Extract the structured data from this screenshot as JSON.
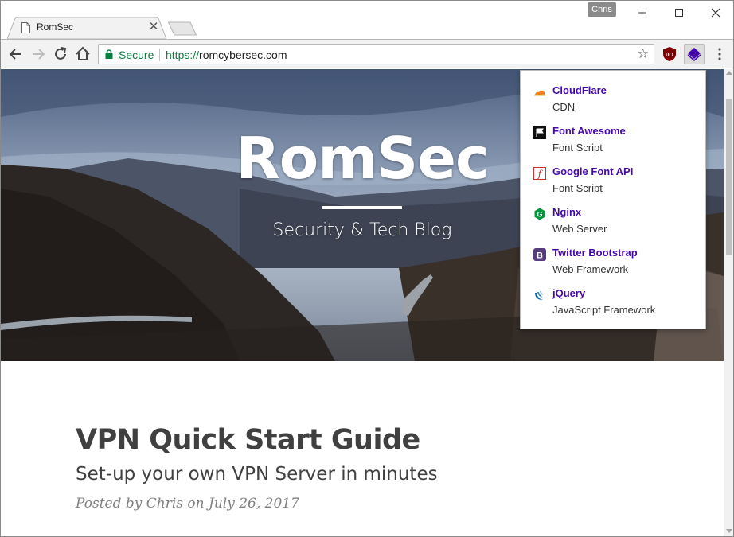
{
  "browser": {
    "tab_title": "RomSec",
    "user_name": "Chris",
    "secure_label": "Secure",
    "url_scheme": "https://",
    "url_host": "romcybersec.com"
  },
  "hero": {
    "title": "RomSec",
    "tagline": "Security & Tech Blog"
  },
  "post": {
    "title": "VPN Quick Start Guide",
    "subtitle": "Set-up your own VPN Server in minutes",
    "meta": "Posted by Chris on July 26, 2017"
  },
  "wappalyzer": {
    "items": [
      {
        "name": "CloudFlare",
        "category": "CDN",
        "icon": "cloudflare-icon"
      },
      {
        "name": "Font Awesome",
        "category": "Font Script",
        "icon": "font-awesome-icon"
      },
      {
        "name": "Google Font API",
        "category": "Font Script",
        "icon": "google-font-api-icon"
      },
      {
        "name": "Nginx",
        "category": "Web Server",
        "icon": "nginx-icon"
      },
      {
        "name": "Twitter Bootstrap",
        "category": "Web Framework",
        "icon": "bootstrap-icon"
      },
      {
        "name": "jQuery",
        "category": "JavaScript Framework",
        "icon": "jquery-icon"
      }
    ]
  },
  "colors": {
    "tech_link": "#4608ad",
    "secure_green": "#0b8043",
    "post_text": "#404040"
  }
}
